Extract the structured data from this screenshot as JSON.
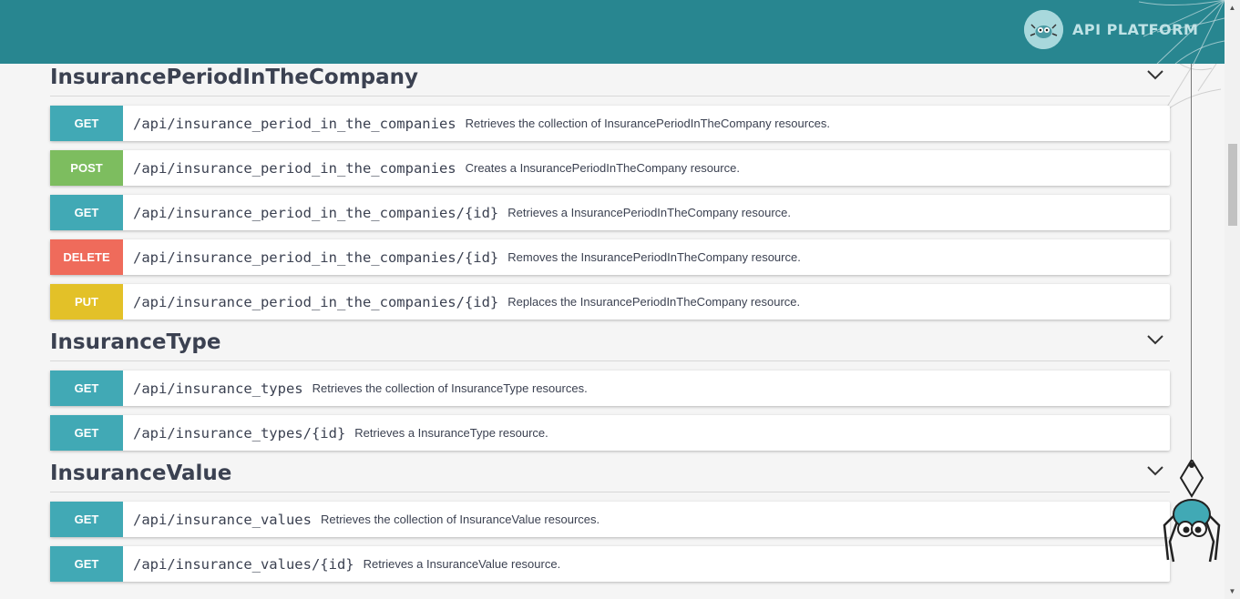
{
  "header": {
    "brand": "API PLATFORM"
  },
  "sections": [
    {
      "title": "InsurancePeriodInTheCompany",
      "operations": [
        {
          "method": "GET",
          "path": "/api/insurance_period_in_the_companies",
          "description": "Retrieves the collection of InsurancePeriodInTheCompany resources."
        },
        {
          "method": "POST",
          "path": "/api/insurance_period_in_the_companies",
          "description": "Creates a InsurancePeriodInTheCompany resource."
        },
        {
          "method": "GET",
          "path": "/api/insurance_period_in_the_companies/{id}",
          "description": "Retrieves a InsurancePeriodInTheCompany resource."
        },
        {
          "method": "DELETE",
          "path": "/api/insurance_period_in_the_companies/{id}",
          "description": "Removes the InsurancePeriodInTheCompany resource."
        },
        {
          "method": "PUT",
          "path": "/api/insurance_period_in_the_companies/{id}",
          "description": "Replaces the InsurancePeriodInTheCompany resource."
        }
      ]
    },
    {
      "title": "InsuranceType",
      "operations": [
        {
          "method": "GET",
          "path": "/api/insurance_types",
          "description": "Retrieves the collection of InsuranceType resources."
        },
        {
          "method": "GET",
          "path": "/api/insurance_types/{id}",
          "description": "Retrieves a InsuranceType resource."
        }
      ]
    },
    {
      "title": "InsuranceValue",
      "operations": [
        {
          "method": "GET",
          "path": "/api/insurance_values",
          "description": "Retrieves the collection of InsuranceValue resources."
        },
        {
          "method": "GET",
          "path": "/api/insurance_values/{id}",
          "description": "Retrieves a InsuranceValue resource."
        }
      ]
    }
  ],
  "colors": {
    "header": "#288690",
    "get": "#41a9b5",
    "post": "#7dbd5f",
    "delete": "#ef6b5b",
    "put": "#e3c128"
  }
}
